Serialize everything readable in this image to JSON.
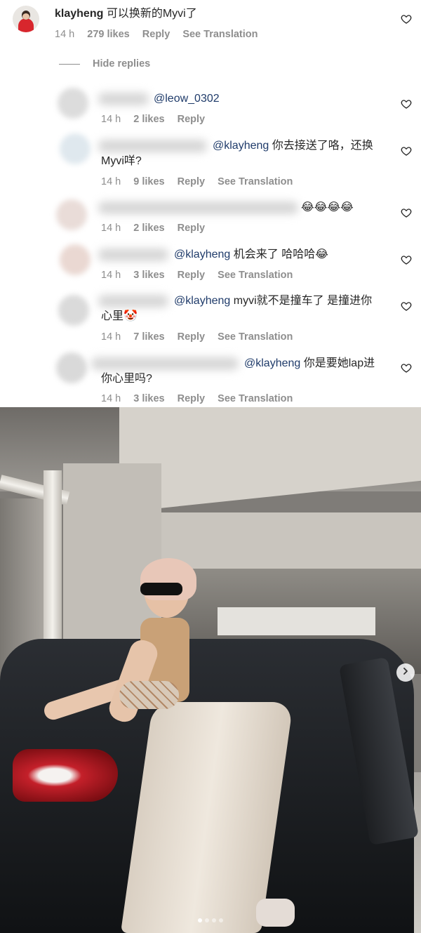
{
  "main_comment": {
    "username": "klayheng",
    "text": "可以换新的Myvi了",
    "time": "14 h",
    "likes": "279 likes",
    "reply": "Reply",
    "translate": "See Translation"
  },
  "hide_replies": "Hide replies",
  "replies": [
    {
      "mention": "@leow_0302",
      "text": "",
      "text2": "",
      "time": "14 h",
      "likes": "2 likes",
      "reply": "Reply",
      "translate": ""
    },
    {
      "mention": "@klayheng",
      "text": " 你去接送了咯，还换",
      "text2": "Myvi咩?",
      "time": "14 h",
      "likes": "9 likes",
      "reply": "Reply",
      "translate": "See Translation"
    },
    {
      "mention": "",
      "text": "😂😂😂😂",
      "text2": "",
      "time": "14 h",
      "likes": "2 likes",
      "reply": "Reply",
      "translate": ""
    },
    {
      "mention": "@klayheng",
      "text": " 机会来了 哈哈哈😂",
      "text2": "",
      "time": "14 h",
      "likes": "3 likes",
      "reply": "Reply",
      "translate": "See Translation"
    },
    {
      "mention": "@klayheng",
      "text": " myvi就不是撞车了 是撞进你",
      "text2": "心里🤡",
      "time": "14 h",
      "likes": "7 likes",
      "reply": "Reply",
      "translate": "See Translation"
    },
    {
      "mention": "@klayheng",
      "text": " 你是要她lap进",
      "text2": "你心里吗?",
      "time": "14 h",
      "likes": "3 likes",
      "reply": "Reply",
      "translate": "See Translation"
    }
  ],
  "carousel": {
    "total": 4,
    "active": 1
  },
  "icons": {
    "like": "heart-outline-icon",
    "next": "chevron-right-icon"
  }
}
